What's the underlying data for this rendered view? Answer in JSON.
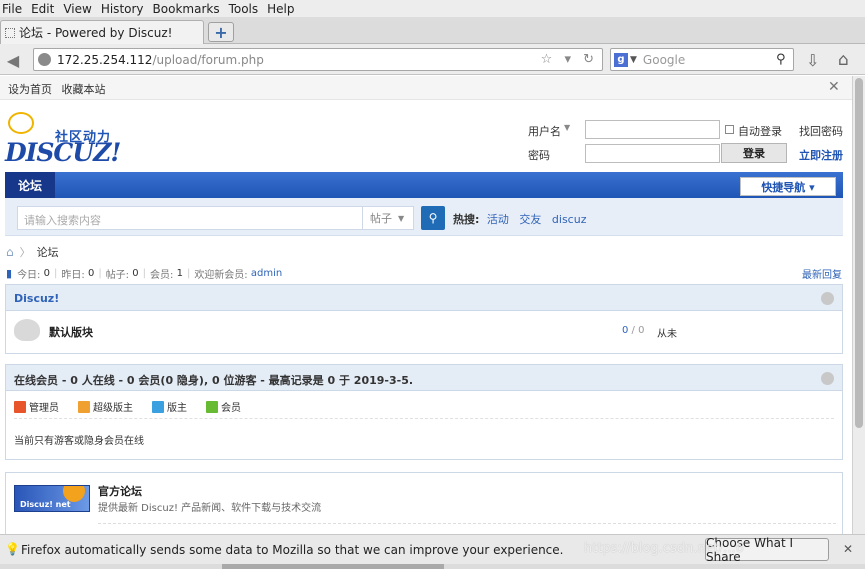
{
  "browser": {
    "menu": [
      "File",
      "Edit",
      "View",
      "History",
      "Bookmarks",
      "Tools",
      "Help"
    ],
    "tab_title": "论坛 - Powered by Discuz!",
    "newtab_symbol": "+",
    "url_host": "172.25.254.112",
    "url_path": "/upload/forum.php",
    "search_engine": "Google",
    "notification": "Firefox automatically sends some data to Mozilla so that we can improve your experience.",
    "notification_button": "Choose What I Share",
    "watermark": "https://blog.csdn.net/...6"
  },
  "page": {
    "top_links": [
      "设为首页",
      "收藏本站"
    ],
    "logo_tagline": "社区动力",
    "logo_word": "DISCUZ!",
    "login": {
      "username_label": "用户名",
      "password_label": "密码",
      "remember_label": "自动登录",
      "login_button": "登录",
      "find_password": "找回密码",
      "register": "立即注册"
    },
    "nav": {
      "current": "论坛",
      "quick_nav": "快捷导航 ▾"
    },
    "search": {
      "placeholder": "请输入搜索内容",
      "type": "帖子",
      "hot_label": "热搜:",
      "hot_items": [
        "活动",
        "交友",
        "discuz"
      ]
    },
    "breadcrumb": "论坛",
    "stats": {
      "today_label": "今日:",
      "today": "0",
      "yesterday_label": "昨日:",
      "yesterday": "0",
      "posts_label": "帖子:",
      "posts": "0",
      "members_label": "会员:",
      "members": "1",
      "welcome_label": "欢迎新会员:",
      "newest_member": "admin",
      "latest_reply": "最新回复"
    },
    "category": {
      "title": "Discuz!",
      "forum_name": "默认版块",
      "count_threads": "0",
      "count_posts": "0",
      "last_post": "从未"
    },
    "online": {
      "title": "在线会员 - 0 人在线 - 0 会员(0 隐身), 0 位游客 - 最高记录是 0 于 2019-3-5.",
      "legend": [
        {
          "label": "管理员",
          "color": "#e8552a"
        },
        {
          "label": "超级版主",
          "color": "#f0a030"
        },
        {
          "label": "版主",
          "color": "#3aa0e0"
        },
        {
          "label": "会员",
          "color": "#66bb33"
        }
      ],
      "note": "当前只有游客或隐身会员在线"
    },
    "friendlink": {
      "banner_text": "Discuz! net",
      "title": "官方论坛",
      "desc": "提供最新 Discuz! 产品新闻、软件下载与技术交流"
    }
  }
}
